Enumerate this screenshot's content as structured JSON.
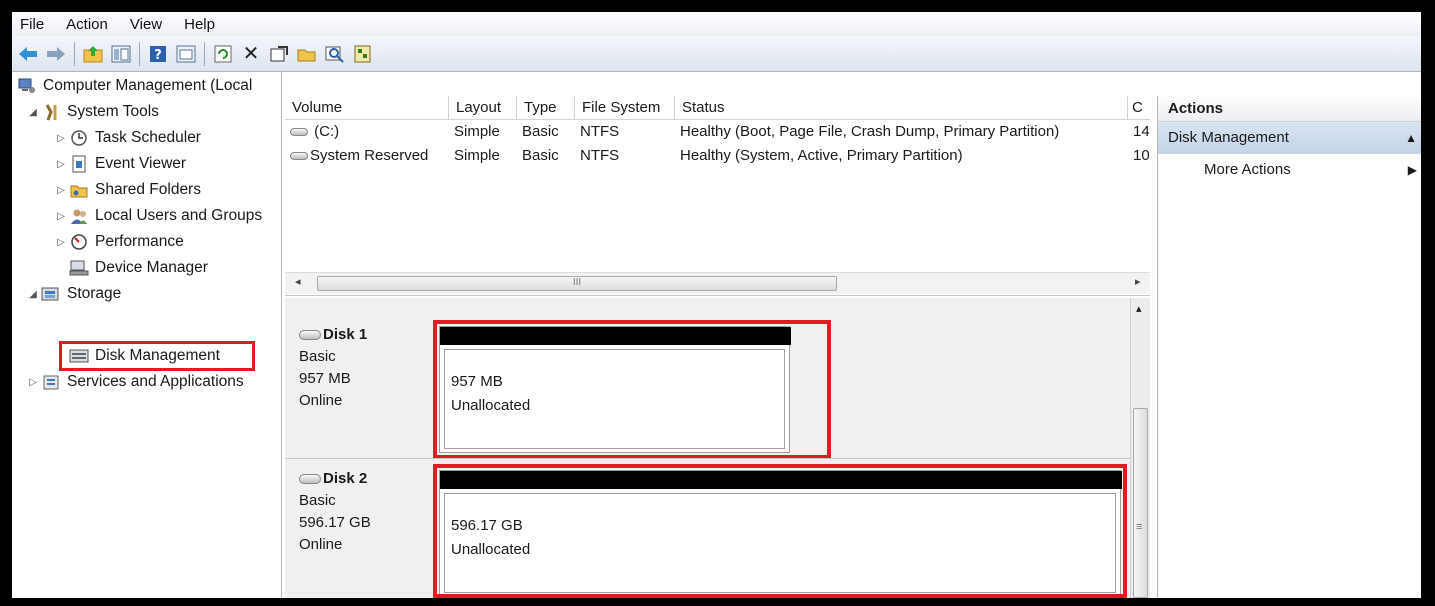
{
  "menu": [
    "File",
    "Action",
    "View",
    "Help"
  ],
  "toolbar": {
    "icons": [
      "back-arrow-icon",
      "forward-arrow-icon",
      "up-folder-icon",
      "show-hide-tree-icon",
      "help-icon",
      "console-view-icon",
      "refresh-icon",
      "delete-icon",
      "properties-icon",
      "open-icon",
      "search-icon",
      "export-icon"
    ],
    "delete_glyph": "✕"
  },
  "tree": {
    "items": [
      {
        "label": "Computer Management (Local",
        "icon": "computer-management-icon",
        "arrow": ""
      },
      {
        "label": "System Tools",
        "icon": "system-tools-icon",
        "arrow": "◢"
      },
      {
        "label": "Task Scheduler",
        "icon": "clock-icon",
        "arrow": "▷"
      },
      {
        "label": "Event Viewer",
        "icon": "event-viewer-icon",
        "arrow": "▷"
      },
      {
        "label": "Shared Folders",
        "icon": "shared-folders-icon",
        "arrow": "▷"
      },
      {
        "label": "Local Users and Groups",
        "icon": "users-icon",
        "arrow": "▷"
      },
      {
        "label": "Performance",
        "icon": "performance-icon",
        "arrow": "▷"
      },
      {
        "label": "Device Manager",
        "icon": "device-manager-icon",
        "arrow": ""
      },
      {
        "label": "Storage",
        "icon": "storage-icon",
        "arrow": "◢"
      },
      {
        "label": "Disk Management",
        "icon": "disk-management-icon",
        "arrow": ""
      },
      {
        "label": "Services and Applications",
        "icon": "services-icon",
        "arrow": "▷"
      }
    ]
  },
  "volumes": {
    "columns": [
      "Volume",
      "Layout",
      "Type",
      "File System",
      "Status",
      "C"
    ],
    "rows": [
      {
        "volume": "(C:)",
        "layout": "Simple",
        "type": "Basic",
        "fs": "NTFS",
        "status": "Healthy (Boot, Page File, Crash Dump, Primary Partition)",
        "cap": "14"
      },
      {
        "volume": "System Reserved",
        "layout": "Simple",
        "type": "Basic",
        "fs": "NTFS",
        "status": "Healthy (System, Active, Primary Partition)",
        "cap": "10"
      }
    ],
    "scroll_thumb_glyph": "III",
    "scroll_left": "◂",
    "scroll_right": "▸"
  },
  "disks": [
    {
      "name": "Disk 1",
      "type": "Basic",
      "size": "957 MB",
      "status": "Online",
      "part_size": "957 MB",
      "part_state": "Unallocated"
    },
    {
      "name": "Disk 2",
      "type": "Basic",
      "size": "596.17 GB",
      "status": "Online",
      "part_size": "596.17 GB",
      "part_state": "Unallocated"
    }
  ],
  "disk_scroll": {
    "up": "▴",
    "grip": "≡"
  },
  "actions": {
    "title": "Actions",
    "section": "Disk Management",
    "section_caret": "▲",
    "item": "More Actions",
    "item_caret": "▶"
  },
  "colors": {
    "highlight": "#e01b22",
    "partition_bar": "#000000",
    "actions_section": "#c4d3e8"
  }
}
